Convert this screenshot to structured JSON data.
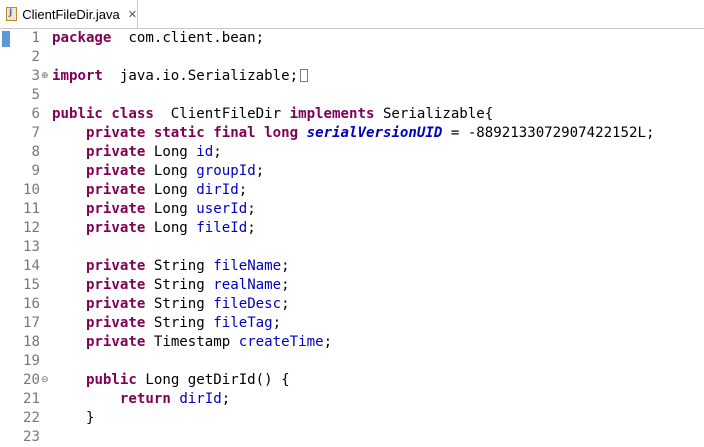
{
  "tab": {
    "label": "ClientFileDir.java",
    "close_glyph": "✕",
    "icon": "java-file-icon"
  },
  "colors": {
    "keyword": "#7f0055",
    "field": "#0000c0",
    "line_number": "#787878",
    "current_line_marker": "#5b9bd5"
  },
  "lines": [
    {
      "n": "1",
      "fold": "",
      "tokens": [
        [
          "kw",
          "package"
        ],
        [
          "",
          "  com.client.bean;"
        ]
      ]
    },
    {
      "n": "2",
      "fold": "",
      "tokens": []
    },
    {
      "n": "3",
      "fold": "⊕",
      "tokens": [
        [
          "kw",
          "import"
        ],
        [
          "",
          "  java.io.Serializable;"
        ],
        [
          "box",
          ""
        ]
      ]
    },
    {
      "n": "5",
      "fold": "",
      "tokens": []
    },
    {
      "n": "6",
      "fold": "",
      "tokens": [
        [
          "kw",
          "public class"
        ],
        [
          "",
          "  ClientFileDir "
        ],
        [
          "kw",
          "implements"
        ],
        [
          "",
          " Serializable{"
        ]
      ]
    },
    {
      "n": "7",
      "fold": "",
      "tokens": [
        [
          "",
          "    "
        ],
        [
          "kw",
          "private static final long"
        ],
        [
          "",
          " "
        ],
        [
          "sfld",
          "serialVersionUID"
        ],
        [
          "",
          " = -8892133072907422152L;"
        ]
      ]
    },
    {
      "n": "8",
      "fold": "",
      "tokens": [
        [
          "",
          "    "
        ],
        [
          "kw",
          "private"
        ],
        [
          "",
          " Long "
        ],
        [
          "fld",
          "id"
        ],
        [
          "",
          ";"
        ]
      ]
    },
    {
      "n": "9",
      "fold": "",
      "tokens": [
        [
          "",
          "    "
        ],
        [
          "kw",
          "private"
        ],
        [
          "",
          " Long "
        ],
        [
          "fld",
          "groupId"
        ],
        [
          "",
          ";"
        ]
      ]
    },
    {
      "n": "10",
      "fold": "",
      "tokens": [
        [
          "",
          "    "
        ],
        [
          "kw",
          "private"
        ],
        [
          "",
          " Long "
        ],
        [
          "fld",
          "dirId"
        ],
        [
          "",
          ";"
        ]
      ]
    },
    {
      "n": "11",
      "fold": "",
      "tokens": [
        [
          "",
          "    "
        ],
        [
          "kw",
          "private"
        ],
        [
          "",
          " Long "
        ],
        [
          "fld",
          "userId"
        ],
        [
          "",
          ";"
        ]
      ]
    },
    {
      "n": "12",
      "fold": "",
      "tokens": [
        [
          "",
          "    "
        ],
        [
          "kw",
          "private"
        ],
        [
          "",
          " Long "
        ],
        [
          "fld",
          "fileId"
        ],
        [
          "",
          ";"
        ]
      ]
    },
    {
      "n": "13",
      "fold": "",
      "tokens": []
    },
    {
      "n": "14",
      "fold": "",
      "tokens": [
        [
          "",
          "    "
        ],
        [
          "kw",
          "private"
        ],
        [
          "",
          " String "
        ],
        [
          "fld",
          "fileName"
        ],
        [
          "",
          ";"
        ]
      ]
    },
    {
      "n": "15",
      "fold": "",
      "tokens": [
        [
          "",
          "    "
        ],
        [
          "kw",
          "private"
        ],
        [
          "",
          " String "
        ],
        [
          "fld",
          "realName"
        ],
        [
          "",
          ";"
        ]
      ]
    },
    {
      "n": "16",
      "fold": "",
      "tokens": [
        [
          "",
          "    "
        ],
        [
          "kw",
          "private"
        ],
        [
          "",
          " String "
        ],
        [
          "fld",
          "fileDesc"
        ],
        [
          "",
          ";"
        ]
      ]
    },
    {
      "n": "17",
      "fold": "",
      "tokens": [
        [
          "",
          "    "
        ],
        [
          "kw",
          "private"
        ],
        [
          "",
          " String "
        ],
        [
          "fld",
          "fileTag"
        ],
        [
          "",
          ";"
        ]
      ]
    },
    {
      "n": "18",
      "fold": "",
      "tokens": [
        [
          "",
          "    "
        ],
        [
          "kw",
          "private"
        ],
        [
          "",
          " Timestamp "
        ],
        [
          "fld",
          "createTime"
        ],
        [
          "",
          ";"
        ]
      ]
    },
    {
      "n": "19",
      "fold": "",
      "tokens": []
    },
    {
      "n": "20",
      "fold": "⊖",
      "tokens": [
        [
          "",
          "    "
        ],
        [
          "kw",
          "public"
        ],
        [
          "",
          " Long getDirId() {"
        ]
      ]
    },
    {
      "n": "21",
      "fold": "",
      "tokens": [
        [
          "",
          "        "
        ],
        [
          "kw",
          "return"
        ],
        [
          "",
          " "
        ],
        [
          "fld",
          "dirId"
        ],
        [
          "",
          ";"
        ]
      ]
    },
    {
      "n": "22",
      "fold": "",
      "tokens": [
        [
          "",
          "    }"
        ]
      ]
    },
    {
      "n": "23",
      "fold": "",
      "tokens": []
    }
  ]
}
